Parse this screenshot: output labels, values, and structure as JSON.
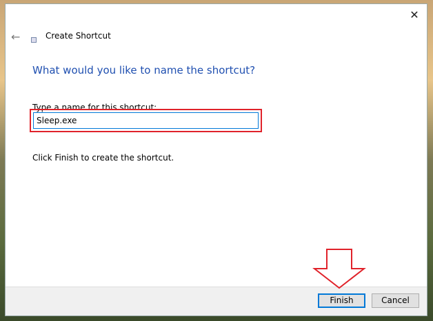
{
  "window": {
    "title": "Create Shortcut",
    "close_icon": "close-icon",
    "back_icon": "back-arrow-icon"
  },
  "main": {
    "heading": "What would you like to name the shortcut?",
    "name_label": "Type a name for this shortcut:",
    "name_value": "Sleep.exe",
    "info": "Click Finish to create the shortcut."
  },
  "footer": {
    "finish_label": "Finish",
    "cancel_label": "Cancel"
  },
  "colors": {
    "accent": "#0078d7",
    "annotation": "#e0222a",
    "heading": "#1f4fb0"
  }
}
